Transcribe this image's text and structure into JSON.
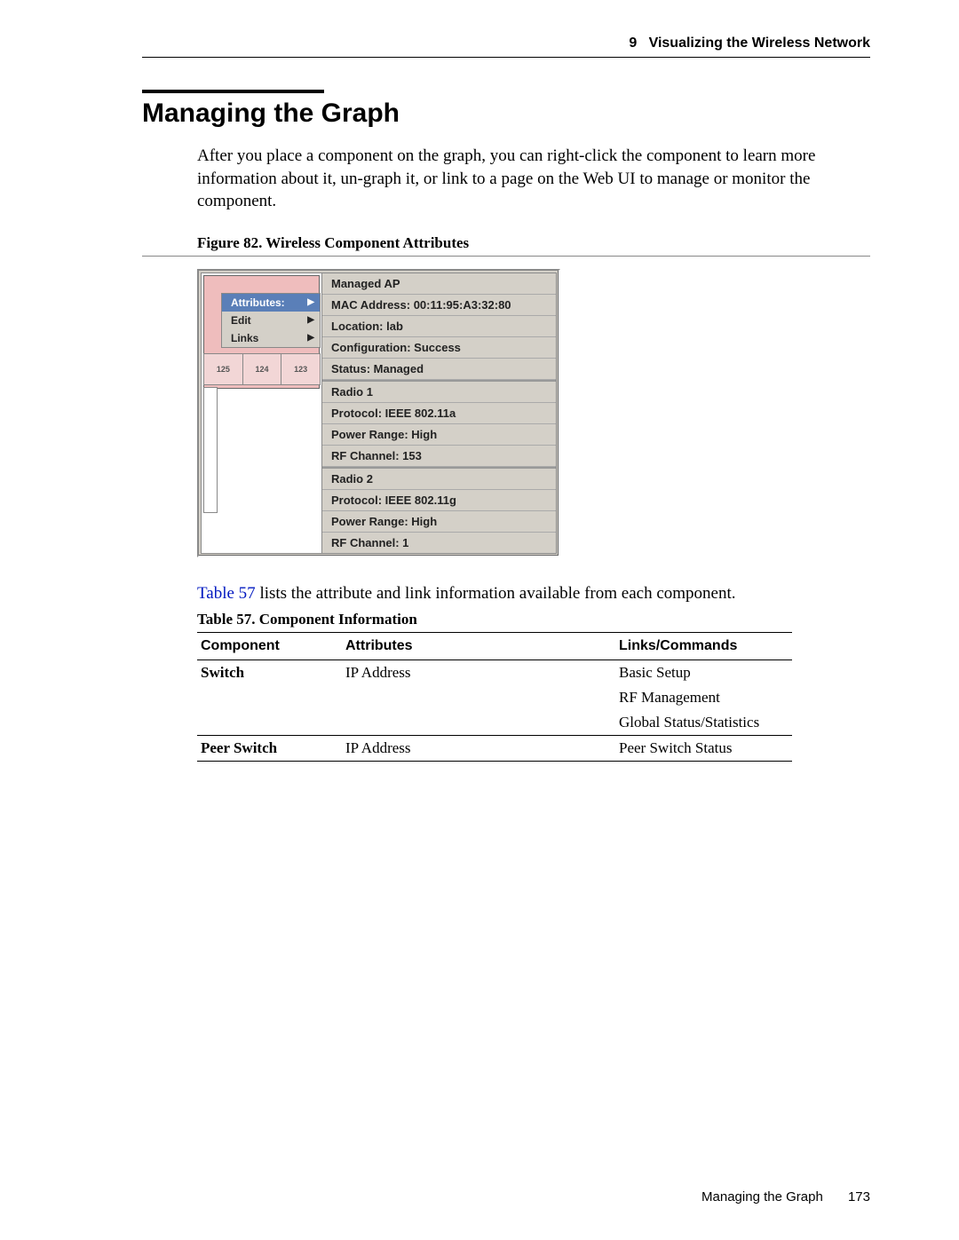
{
  "header": {
    "chapter_num": "9",
    "chapter_title": "Visualizing the Wireless Network"
  },
  "section": {
    "title": "Managing the Graph",
    "intro": "After you place a component on the graph, you can right-click the component to learn more information about it, un-graph it, or link to a page on the Web UI to manage or monitor the component."
  },
  "figure": {
    "caption": "Figure 82.  Wireless Component Attributes",
    "plan_cells": [
      "125",
      "124",
      "123"
    ],
    "menu": {
      "items": [
        {
          "label": "Attributes:",
          "selected": true
        },
        {
          "label": "Edit",
          "selected": false
        },
        {
          "label": "Links",
          "selected": false
        }
      ]
    },
    "panel_lines": {
      "group1": [
        "Managed AP",
        "MAC Address: 00:11:95:A3:32:80",
        "Location: lab",
        "Configuration: Success",
        "Status: Managed"
      ],
      "group2": [
        "Radio 1",
        "Protocol: IEEE 802.11a",
        "Power Range: High",
        "RF Channel: 153"
      ],
      "group3": [
        "Radio 2",
        "Protocol: IEEE 802.11g",
        "Power Range: High",
        "RF Channel: 1"
      ]
    }
  },
  "ref_sentence": {
    "link": "Table 57",
    "rest": " lists the attribute and link information available from each component."
  },
  "table": {
    "caption": "Table 57. Component Information",
    "headers": [
      "Component",
      "Attributes",
      "Links/Commands"
    ],
    "rows": [
      {
        "component": "Switch",
        "attributes": [
          "IP Address"
        ],
        "links": [
          "Basic Setup",
          "RF Management",
          "Global Status/Statistics"
        ]
      },
      {
        "component": "Peer Switch",
        "attributes": [
          "IP Address"
        ],
        "links": [
          "Peer Switch Status"
        ]
      }
    ]
  },
  "footer": {
    "section": "Managing the Graph",
    "page": "173"
  }
}
